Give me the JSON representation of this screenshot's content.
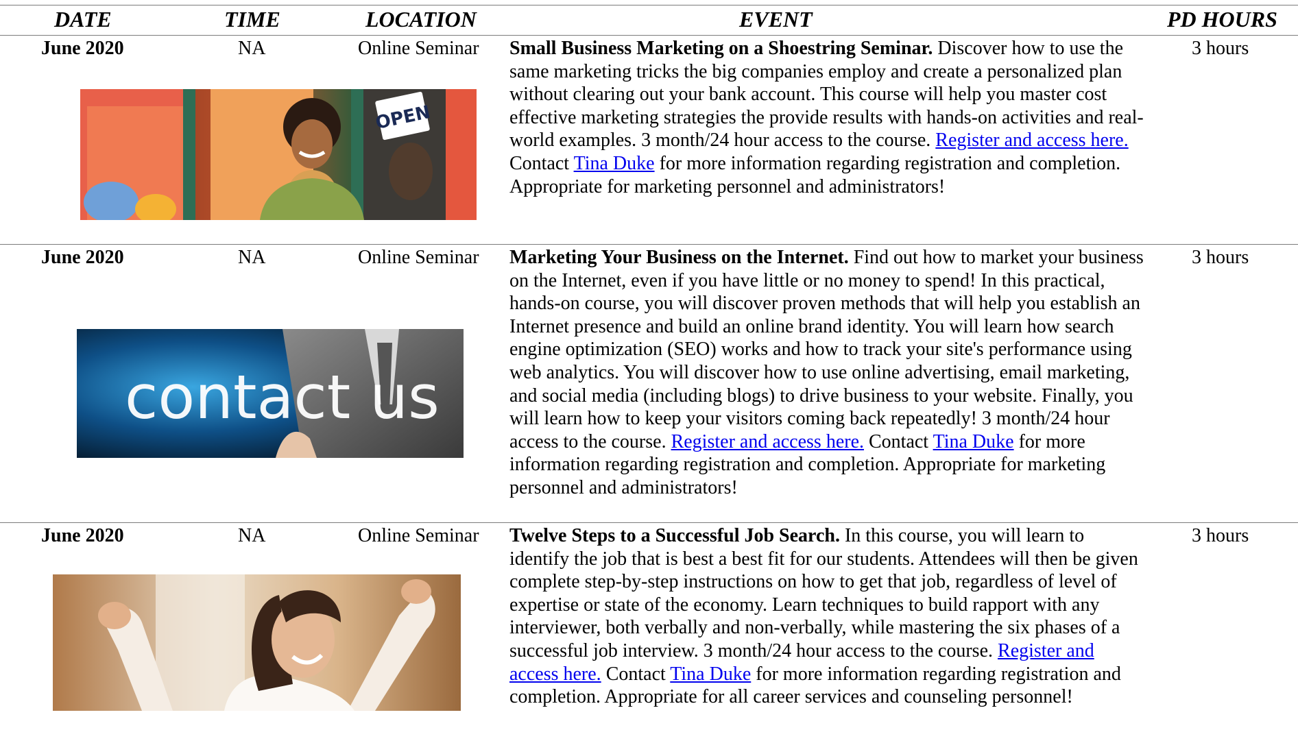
{
  "header": {
    "date": "DATE",
    "time": "TIME",
    "location": "LOCATION",
    "event": "EVENT",
    "pd_hours": "PD HOURS"
  },
  "rows": [
    {
      "date": "June 2020",
      "time": "NA",
      "location": "Online Seminar",
      "title": "Small Business Marketing on a Shoestring Seminar.",
      "description": " Discover how to use the same marketing tricks the big companies employ and create a personalized plan without clearing out your bank account. This course will help you master cost effective marketing strategies the provide results with hands-on activities and real-world examples. 3 month/24 hour access to the course. ",
      "register_link": "Register and access here.",
      "contact_prefix": " Contact ",
      "contact_link": "Tina Duke",
      "closing": " for more information regarding registration and completion. Appropriate for marketing personnel and administrators!",
      "pd_hours": "3 hours",
      "image_sign_text": "OPEN"
    },
    {
      "date": "June 2020",
      "time": "NA",
      "location": "Online Seminar",
      "title": "Marketing Your Business on the Internet.",
      "description": " Find out how to market your business on the Internet, even if you have little or no money to spend! In this practical, hands-on course, you will discover proven methods that will help you establish an Internet presence and build an online brand identity. You will learn how search engine optimization (SEO) works and how to track your site's performance using web analytics. You will discover how to use online advertising, email marketing, and social media (including blogs) to drive business to your website. Finally, you will learn how to keep your visitors coming back repeatedly! 3 month/24 hour access to the course. ",
      "register_link": "Register and access here.",
      "contact_prefix": " Contact ",
      "contact_link": "Tina Duke",
      "closing": " for more information regarding registration and completion. Appropriate for marketing personnel and administrators!",
      "pd_hours": "3 hours",
      "image_text": "contact us"
    },
    {
      "date": "June 2020",
      "time": "NA",
      "location": "Online Seminar",
      "title": "Twelve Steps to a Successful Job Search.",
      "description": " In this course, you will learn to identify the job that is best a best fit for our students. Attendees will then be given complete step-by-step instructions on how to get that job, regardless of level of expertise or state of the economy. Learn techniques to build rapport with any interviewer, both verbally and non-verbally, while mastering the six phases of a successful job interview. 3 month/24 hour access to the course. ",
      "register_link": "Register and access here.",
      "contact_prefix": " Contact ",
      "contact_link": "Tina Duke",
      "closing": " for more information regarding registration and completion. Appropriate for all career services and counseling personnel!",
      "pd_hours": "3 hours"
    }
  ],
  "colors": {
    "link": "#0000ee",
    "rule": "#7a7a7a"
  }
}
